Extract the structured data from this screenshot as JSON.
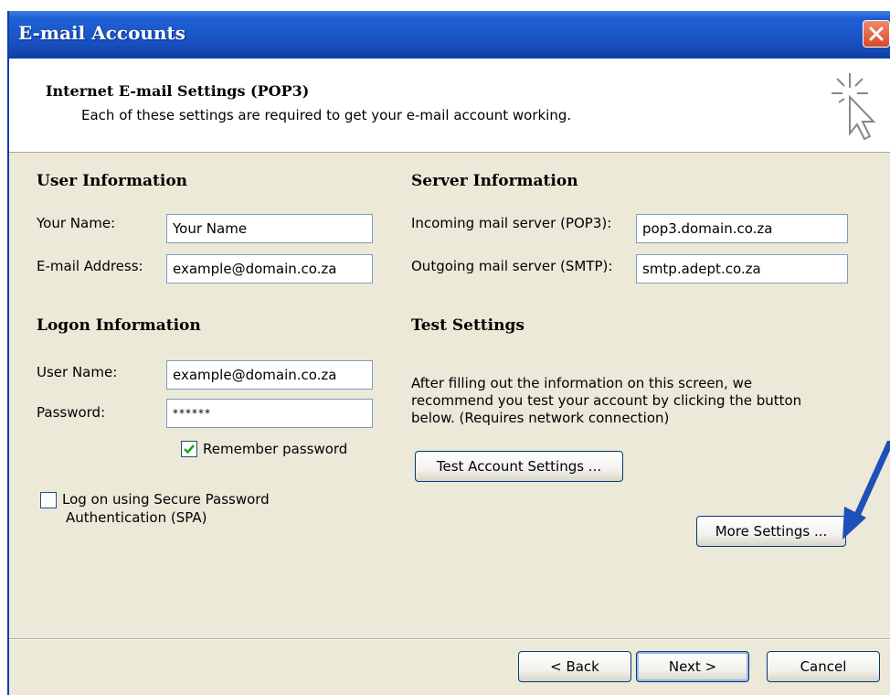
{
  "window": {
    "title": "E-mail Accounts"
  },
  "header": {
    "title": "Internet E-mail Settings (POP3)",
    "subtitle": "Each of these settings are required to get your e-mail account working."
  },
  "user_info": {
    "heading": "User Information",
    "name_label": "Your Name:",
    "name_value": "Your Name",
    "email_label": "E-mail Address:",
    "email_value": "example@domain.co.za"
  },
  "logon_info": {
    "heading": "Logon Information",
    "username_label": "User Name:",
    "username_value": "example@domain.co.za",
    "password_label": "Password:",
    "password_value": "******",
    "remember_label": "Remember password",
    "remember_checked": true,
    "spa_label_line1": "Log on using Secure Password",
    "spa_label_line2": "Authentication (SPA)",
    "spa_checked": false
  },
  "server_info": {
    "heading": "Server Information",
    "incoming_label": "Incoming mail server (POP3):",
    "incoming_value": "pop3.domain.co.za",
    "outgoing_label": "Outgoing mail server (SMTP):",
    "outgoing_value": "smtp.adept.co.za"
  },
  "test_settings": {
    "heading": "Test Settings",
    "description": "After filling out the information on this screen, we recommend you test your account by clicking the button below. (Requires network connection)",
    "test_button": "Test Account Settings ...",
    "more_button": "More Settings ..."
  },
  "footer": {
    "back_button": "< Back",
    "next_button": "Next >",
    "cancel_button": "Cancel"
  },
  "colors": {
    "titlebar": "#1a56c8",
    "dialog_bg": "#ece9d8",
    "checkbox_check": "#21a121",
    "arrow": "#1f4fb8"
  },
  "icons": [
    "close-icon",
    "wizard-cursor-icon",
    "checkmark-icon",
    "annotation-arrow-icon"
  ]
}
